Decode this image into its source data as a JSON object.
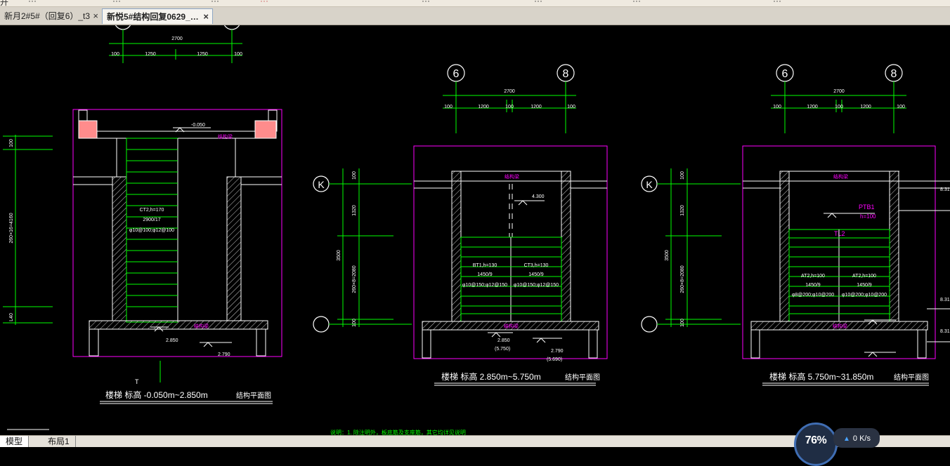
{
  "tabs": [
    {
      "label": "新月2#5#（回复6）_t3",
      "close": "×"
    },
    {
      "label": "新悦5#结构回复0629_…",
      "close": "×"
    }
  ],
  "layout_tabs": {
    "model": "模型",
    "layout1": "布局1"
  },
  "net_widget": {
    "percent": "76%",
    "speed": "0 K/s"
  },
  "grid_bubbles": {
    "g6": "6",
    "g8": "8",
    "gK": "K"
  },
  "plan1": {
    "dim_top": "2700",
    "dim_left": "100",
    "dim_a": "1250",
    "dim_b": "1250",
    "dim_right": "100",
    "elev_top": "-0.050",
    "beam_top": "结构梁",
    "stair_label": "CT2,h=170",
    "stair_steps": "2900/17",
    "stair_rebar": "φ10@100;φ12@100",
    "elev_bottom": "2.850",
    "elev_bottom2": "2.790",
    "beam_bottom": "结构梁",
    "vdim_top": "100",
    "vdim_main": "260×16=4160",
    "vdim_bot": "L40",
    "title": "楼梯  标高 -0.050m~2.850m",
    "subtitle": "结构平面图",
    "section_mark": "T"
  },
  "plan2": {
    "dim_top": "2700",
    "dim_left": "100",
    "dim_a": "1200",
    "dim_mid": "100",
    "dim_b": "1200",
    "dim_right": "100",
    "beam_top": "结构梁",
    "elev_landing": "4.300",
    "stair1_label": "BT1,h=130",
    "stair1_steps": "1450/9",
    "stair1_rebar": "φ10@150;φ12@150",
    "stair2_label": "CT3,h=130",
    "stair2_steps": "1450/9",
    "stair2_rebar": "φ10@150;φ12@150",
    "beam_bottom": "结构梁",
    "elev_bottom": "2.850",
    "elev_bottom_b": "(5.750)",
    "elev_r1": "2.790",
    "elev_r2": "(5.690)",
    "vdim_top": "100",
    "vdim_1320": "1320",
    "vdim_total": "3500",
    "vdim_steps": "260×8=2080",
    "vdim_bot": "100",
    "title": "楼梯  标高 2.850m~5.750m",
    "subtitle": "结构平面图"
  },
  "plan3": {
    "dim_top": "2700",
    "dim_left": "100",
    "dim_a": "1200",
    "dim_mid": "100",
    "dim_b": "1200",
    "dim_right": "100",
    "beam_top": "结构梁",
    "ptb_label": "PTB1",
    "ptb_h": "h=100",
    "tl_label": "TL2",
    "stair1_label": "AT2,h=100",
    "stair1_steps": "1450/9",
    "stair1_rebar": "φ8@200;φ10@200",
    "stair2_label": "AT2,h=100",
    "stair2_steps": "1450/9",
    "stair2_rebar": "φ10@200;φ10@200",
    "beam_bottom": "结构梁",
    "vdim_top": "100",
    "vdim_1320": "1320",
    "vdim_total": "3500",
    "vdim_steps": "260×8=2080",
    "vdim_bot": "100",
    "edge_1": "8.31",
    "edge_2": "8.31",
    "edge_3": "8.31",
    "title": "楼梯  标高 5.750m~31.850m",
    "subtitle": "结构平面图"
  },
  "bottom_note": "说明：1. 除注明外，板底筋及支座筋，其它均详见说明",
  "colors": {
    "canvas": "#000000",
    "green": "#00ff00",
    "magenta": "#ff00ff",
    "yellow": "#ffff00",
    "white": "#ffffff",
    "hatch": "#ff8080"
  }
}
